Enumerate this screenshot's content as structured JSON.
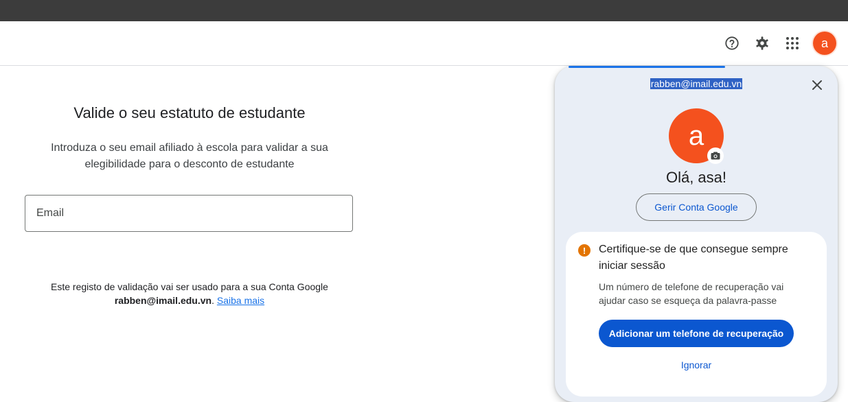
{
  "header": {
    "icons": [
      "help-icon",
      "settings-icon",
      "apps-icon"
    ],
    "avatar_letter": "a"
  },
  "main": {
    "title": "Valide o seu estatuto de estudante",
    "subtitle": "Introduza o seu email afiliado à escola para validar a sua elegibilidade para o desconto de estudante",
    "email_placeholder": "Email",
    "email_value": "",
    "footnote_text": "Este registo de validação vai ser usado para a sua Conta Google",
    "footnote_email": "rabben@imail.edu.vn",
    "footnote_period": ". ",
    "learn_more": "Saiba mais"
  },
  "account_panel": {
    "email": "rabben@imail.edu.vn",
    "avatar_letter": "a",
    "greeting": "Olá, asa!",
    "manage_button": "Gerir Conta Google",
    "card": {
      "title": "Certifique-se de que consegue sempre iniciar sessão",
      "body": "Um número de telefone de recuperação vai ajudar caso se esqueça da palavra-passe",
      "add_button": "Adicionar um telefone de recuperação",
      "ignore_link": "Ignorar",
      "warning_glyph": "!"
    }
  },
  "colors": {
    "avatar": "#f4511e",
    "primary_blue": "#0b57d0",
    "panel_bg": "#e9eef6",
    "warning": "#e37400"
  }
}
